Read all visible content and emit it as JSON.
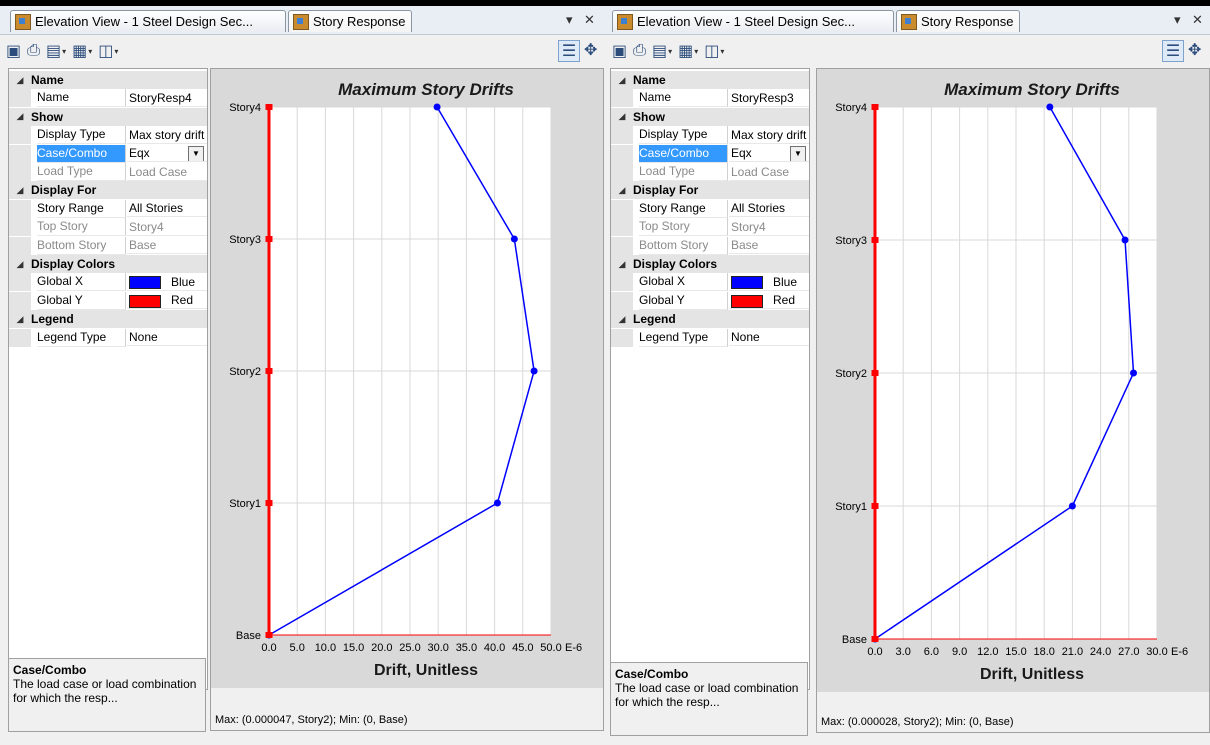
{
  "tabs": {
    "elevation_label": "Elevation View - 1  Steel Design Sec...",
    "story_label": "Story Response",
    "pin_glyph": "▾",
    "close_glyph": "✕"
  },
  "toolbar_icons": [
    "save-icon",
    "print-icon",
    "export-image-icon",
    "table-icon",
    "chart-icon"
  ],
  "property_labels": {
    "cat_name": "Name",
    "name": "Name",
    "cat_show": "Show",
    "display_type": "Display Type",
    "case_combo": "Case/Combo",
    "load_type": "Load Type",
    "cat_display_for": "Display For",
    "story_range": "Story Range",
    "top_story": "Top Story",
    "bottom_story": "Bottom Story",
    "cat_display_colors": "Display Colors",
    "global_x": "Global X",
    "global_y": "Global Y",
    "cat_legend": "Legend",
    "legend_type": "Legend Type"
  },
  "help": {
    "title": "Case/Combo",
    "description": "The load case or load combination for which the resp..."
  },
  "colors": {
    "global_x": "#0000ff",
    "global_y": "#ff0000",
    "selection": "#3399ff"
  },
  "panels": [
    {
      "properties": {
        "name": "StoryResp4",
        "display_type": "Max story drift",
        "case_combo": "Eqx",
        "load_type": "Load Case",
        "story_range": "All Stories",
        "top_story": "Story4",
        "bottom_story": "Base",
        "global_x_color": "Blue",
        "global_y_color": "Red",
        "legend_type": "None"
      },
      "status": "Max: (0.000047, Story2);   Min: (0, Base)"
    },
    {
      "properties": {
        "name": "StoryResp3",
        "display_type": "Max story drift",
        "case_combo": "Eqx",
        "load_type": "Load Case",
        "story_range": "All Stories",
        "top_story": "Story4",
        "bottom_story": "Base",
        "global_x_color": "Blue",
        "global_y_color": "Red",
        "legend_type": "None"
      },
      "status": "Max: (0.000028, Story2);   Min: (0, Base)"
    }
  ],
  "chart_data": [
    {
      "type": "line",
      "title": "Maximum Story Drifts",
      "xlabel": "Drift, Unitless",
      "x_unit_suffix": "E-6",
      "x_ticks": [
        "0.0",
        "5.0",
        "10.0",
        "15.0",
        "20.0",
        "25.0",
        "30.0",
        "35.0",
        "40.0",
        "45.0",
        "50.0"
      ],
      "xlim": [
        0,
        50
      ],
      "categories": [
        "Base",
        "Story1",
        "Story2",
        "Story3",
        "Story4"
      ],
      "series": [
        {
          "color": "#0000ff",
          "values": [
            0,
            40.5,
            47.0,
            43.5,
            29.8
          ]
        },
        {
          "color": "#ff0000",
          "values": [
            0,
            0,
            0,
            0,
            0
          ]
        }
      ],
      "grid": true
    },
    {
      "type": "line",
      "title": "Maximum Story Drifts",
      "xlabel": "Drift, Unitless",
      "x_unit_suffix": "E-6",
      "x_ticks": [
        "0.0",
        "3.0",
        "6.0",
        "9.0",
        "12.0",
        "15.0",
        "18.0",
        "21.0",
        "24.0",
        "27.0",
        "30.0"
      ],
      "xlim": [
        0,
        30
      ],
      "categories": [
        "Base",
        "Story1",
        "Story2",
        "Story3",
        "Story4"
      ],
      "series": [
        {
          "color": "#0000ff",
          "values": [
            0,
            21.0,
            27.5,
            26.6,
            18.6
          ]
        },
        {
          "color": "#ff0000",
          "values": [
            0,
            0,
            0,
            0,
            0
          ]
        }
      ],
      "grid": true
    }
  ]
}
